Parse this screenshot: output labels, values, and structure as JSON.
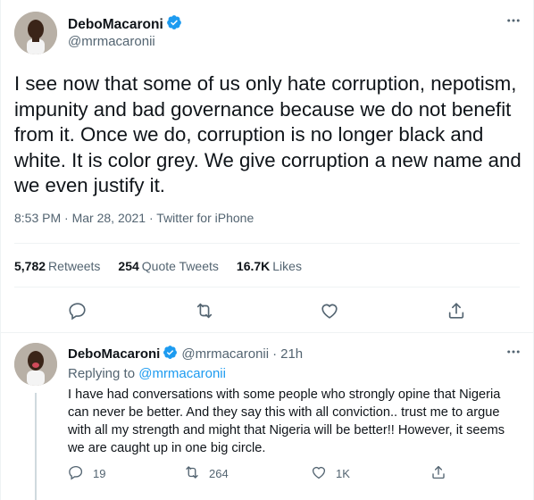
{
  "tweet": {
    "author_name": "DeboMacaroni",
    "author_handle": "@mrmacaronii",
    "text": "I see now that some of us only hate corruption, nepotism, impunity and bad governance because we do not benefit from it. Once we do, corruption is no longer black and white. It is color grey. We give corruption a new name and we even justify it.",
    "time": "8:53 PM",
    "date": "Mar 28, 2021",
    "source": "Twitter for iPhone",
    "separator": "·",
    "stats": {
      "retweets_count": "5,782",
      "retweets_label": "Retweets",
      "quotes_count": "254",
      "quotes_label": "Quote Tweets",
      "likes_count": "16.7K",
      "likes_label": "Likes"
    },
    "icons": [
      "reply-icon",
      "retweet-icon",
      "like-icon",
      "share-icon",
      "more-icon",
      "verified-icon"
    ]
  },
  "reply": {
    "author_name": "DeboMacaroni",
    "author_handle": "@mrmacaronii",
    "separator": "·",
    "age": "21h",
    "replying_prefix": "Replying to",
    "replying_to": "@mrmacaronii",
    "text": "I have had conversations with some people who strongly opine that Nigeria can never be better. And they say this with all conviction.. trust me to argue with all my strength and might that Nigeria will be better!! However, it seems we are caught up in one big circle.",
    "reply_count": "19",
    "retweet_count": "264",
    "like_count": "1K"
  },
  "colors": {
    "accent": "#1d9bf0",
    "text": "#0f1419",
    "secondary": "#536471",
    "divider": "#eff3f4"
  }
}
